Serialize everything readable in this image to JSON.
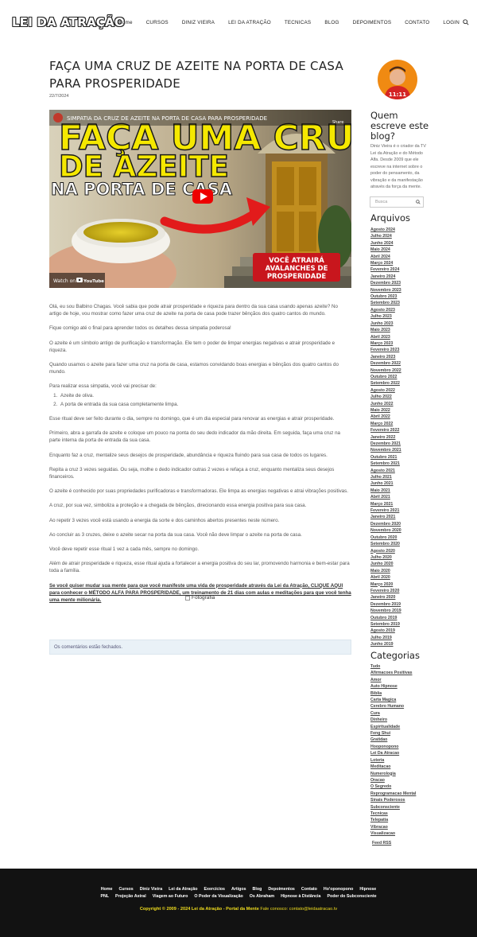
{
  "header": {
    "logo": "LEI DA ATRAÇÃO",
    "nav": [
      "Home",
      "CURSOS",
      "DINIZ VIEIRA",
      "LEI DA ATRAÇÃO",
      "TECNICAS",
      "BLOG",
      "DEPOIMENTOS",
      "CONTATO",
      "LOGIN"
    ],
    "search_icon": "search-icon"
  },
  "post": {
    "title": "FAÇA UMA CRUZ DE AZEITE NA PORTA DE CASA PARA PROSPERIDADE",
    "date": "22/7/2024",
    "video": {
      "title": "SIMPATIA DA CRUZ DE AZEITE NA PORTA DE CASA PARA PROSPERIDADE",
      "headline_1": "FAÇA UMA CRUZ",
      "headline_2": "DE AZEITE",
      "headline_3": "NA PORTA DE CASA",
      "badge_1": "VOCÊ ATRAIRÁ",
      "badge_2": "AVALANCHES DE",
      "badge_3": "PROSPERIDADE",
      "watch_on": "Watch on",
      "youtube": "YouTube",
      "share": "Share"
    },
    "paragraphs": [
      "Olá, eu sou Balbino Chagas. Você sabia que pode atrair prosperidade e riqueza para dentro da sua casa usando apenas azeite? No artigo de hoje, vou mostrar como fazer uma cruz de azeite na porta de casa pode trazer bênçãos dos quatro cantos do mundo.",
      "Fique comigo até o final para aprender todos os detalhes dessa simpatia poderosa!",
      "O azeite é um símbolo antigo de purificação e transformação. Ele tem o poder de limpar energias negativas e atrair prosperidade e riqueza.",
      "Quando usamos o azeite para fazer uma cruz na porta de casa, estamos convidando boas energias e bênçãos dos quatro cantos do mundo.",
      "Para realizar essa simpatia, você vai precisar de:"
    ],
    "list": [
      "Azeite de oliva.",
      "A porta de entrada da sua casa completamente limpa."
    ],
    "paragraphs2": [
      "Esse ritual deve ser feito durante o dia, sempre no domingo, que é um dia especial para renovar as energias e atrair prosperidade.",
      "Primeiro, abra a garrafa de azeite e coloque um pouco na ponta do seu dedo indicador da mão direita. Em seguida, faça uma cruz na parte interna da porta de entrada da sua casa.",
      "Enquanto faz a cruz, mentalize seus desejos de prosperidade, abundância e riqueza fluindo para sua casa de todos os lugares.",
      "Repita a cruz 3 vezes seguidas. Ou seja, molhe o dedo indicador outras 2 vezes e refaça a cruz, enquanto mentaliza seus desejos financeiros.",
      "O azeite é conhecido por suas propriedades purificadoras e transformadoras. Ele limpa as energias negativas e atrai vibrações positivas.",
      "A cruz, por sua vez, simboliza a proteção e a chegada de bênçãos, direcionando essa energia positiva para sua casa.",
      "Ao repetir 3 vezes você está usando a energia da sorte e dos caminhos abertos presentes neste número.",
      "Ao concluir as 3 cruzes, deixe o azeite secar na porta da sua casa. Você não deve limpar o azeite na porta de casa.",
      "Você deve repetir esse ritual 1 vez a cada mês, sempre no domingo.",
      "Além de atrair prosperidade e riqueza, esse ritual ajuda a fortalecer a energia positiva do seu lar, promovendo harmonia e bem-estar para toda a família."
    ],
    "cta": "Se você quiser mudar sua mente para que você manifeste uma vida de prosperidade através da Lei da Atração, CLIQUE AQUI para conhecer o MÉTODO ALFA PARA PROSPERIDADE, um treinamento de 21 dias com aulas e meditações para que você tenha uma mente milionária.",
    "photo_alt": "Fotografia",
    "comments_closed": "Os comentários estão fechados."
  },
  "sidebar": {
    "about_title": "Quem escreve este blog?",
    "about_text": "Diniz Vieira é o criador da TV Lei da Atração e do Método Alfa. Desde 2009 que ele escreve na internet sobre o poder do pensamento, da vibração e da manifestação através da força da mente.",
    "search_placeholder": "Busca",
    "archives_title": "Arquivos",
    "archives": [
      "Agosto 2024",
      "Julho 2024",
      "Junho 2024",
      "Maio 2024",
      "Abril 2024",
      "Março 2024",
      "Fevereiro 2024",
      "Janeiro 2024",
      "Dezembro 2023",
      "Novembro 2023",
      "Outubro 2023",
      "Setembro 2023",
      "Agosto 2023",
      "Julho 2023",
      "Junho 2023",
      "Maio 2023",
      "Abril 2023",
      "Março 2023",
      "Fevereiro 2023",
      "Janeiro 2023",
      "Dezembro 2022",
      "Novembro 2022",
      "Outubro 2022",
      "Setembro 2022",
      "Agosto 2022",
      "Julho 2022",
      "Junho 2022",
      "Maio 2022",
      "Abril 2022",
      "Março 2022",
      "Fevereiro 2022",
      "Janeiro 2022",
      "Dezembro 2021",
      "Novembro 2021",
      "Outubro 2021",
      "Setembro 2021",
      "Agosto 2021",
      "Julho 2021",
      "Junho 2021",
      "Maio 2021",
      "Abril 2021",
      "Março 2021",
      "Fevereiro 2021",
      "Janeiro 2021",
      "Dezembro 2020",
      "Novembro 2020",
      "Outubro 2020",
      "Setembro 2020",
      "Agosto 2020",
      "Julho 2020",
      "Junho 2020",
      "Maio 2020",
      "Abril 2020",
      "Março 2020",
      "Fevereiro 2020",
      "Janeiro 2020",
      "Dezembro 2019",
      "Novembro 2019",
      "Outubro 2019",
      "Setembro 2019",
      "Agosto 2019",
      "Julho 2019",
      "Junho 2019"
    ],
    "categories_title": "Categorias",
    "categories": [
      "Tudo",
      "Afirmacoes Positivas",
      "Amor",
      "Auto Hipnose",
      "Biblia",
      "Carta Magica",
      "Cerebro Humano",
      "Cura",
      "Dinheiro",
      "Espiritualidade",
      "Feng Shui",
      "Gratidao",
      "Hooponopono",
      "Lei Da Atracao",
      "Loteria",
      "Meditacao",
      "Numerologia",
      "Oracao",
      "O Segredo",
      "Reprogramacao Mental",
      "Sinais Poderosos",
      "Subconsciente",
      "Tecnicas",
      "Telepatia",
      "Vibracao",
      "Visualizacao"
    ],
    "feed": "Feed RSS"
  },
  "footer": {
    "row1": [
      "Home",
      "Cursos",
      "Diniz Vieira",
      "Lei da Atração",
      "Exercícios",
      "Artigos",
      "Blog",
      "Depoimentos",
      "Contato",
      "Ho'oponopono",
      "Hipnose"
    ],
    "row2": [
      "PNL",
      "Projeção Astral",
      "Viagem ao Futuro",
      "O Poder da Visualização",
      "Os Abraham",
      "Hipnose à Distância",
      "Poder do Subconsciente"
    ],
    "copyright": "Copyright © 2009 - 2024 Lei da Atração - Portal da Mente",
    "contact": "Fale conosco: contato@leidaatracao.tv"
  }
}
